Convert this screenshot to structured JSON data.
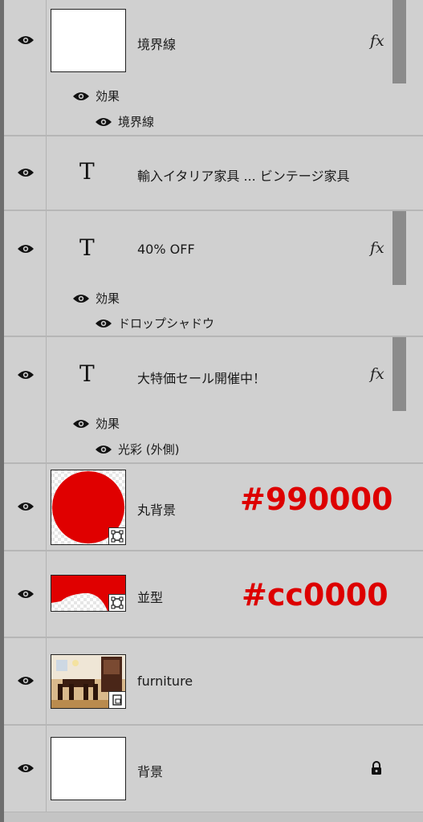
{
  "layers": [
    {
      "name": "境界線",
      "fx": "fx",
      "effects_label": "効果",
      "effects": [
        "境界線"
      ]
    },
    {
      "name": "輸入イタリア家具 ... ビンテージ家具",
      "type_icon": "T"
    },
    {
      "name": "40% OFF",
      "type_icon": "T",
      "fx": "fx",
      "effects_label": "効果",
      "effects": [
        "ドロップシャドウ"
      ]
    },
    {
      "name": "大特価セール開催中！",
      "type_icon": "T",
      "fx": "fx",
      "effects_label": "効果",
      "effects": [
        "光彩 (外側)"
      ]
    },
    {
      "name": "丸背景",
      "annotation": "#990000"
    },
    {
      "name": "並型",
      "annotation": "#cc0000"
    },
    {
      "name": "furniture"
    },
    {
      "name": "背景"
    }
  ],
  "colors": {
    "annotation": "#dd0000",
    "shape_fill": "#e00000",
    "panel_bg": "#d0d0d0"
  },
  "icons": {
    "visibility": "eye-icon",
    "lock": "lock-icon",
    "collapse": "caret-up-icon",
    "vector_mask": "vector-mask-icon",
    "smart_object": "smart-object-icon"
  }
}
